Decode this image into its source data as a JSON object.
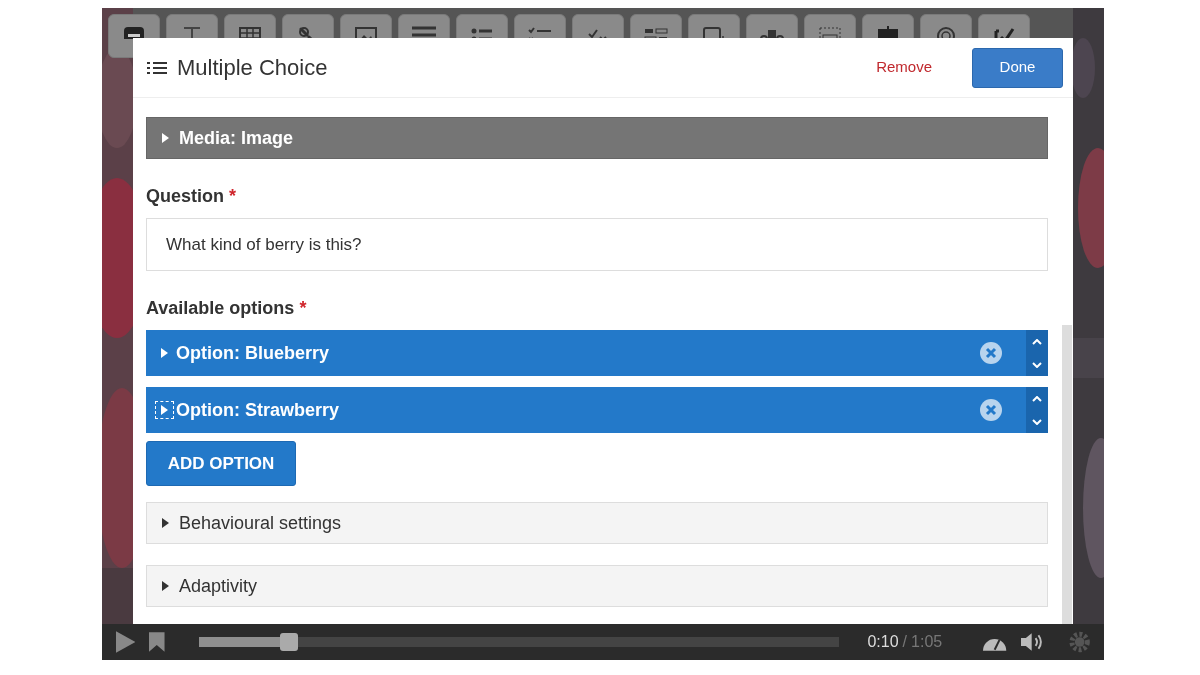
{
  "dialog": {
    "title": "Multiple Choice",
    "remove": "Remove",
    "done": "Done"
  },
  "media": {
    "label": "Media: Image",
    "expanded": false
  },
  "question": {
    "label": "Question",
    "required": "*",
    "value": "What kind of berry is this?"
  },
  "options": {
    "label": "Available options",
    "required": "*",
    "add_button": "ADD OPTION",
    "items": [
      {
        "label": "Option: Blueberry",
        "focused": false
      },
      {
        "label": "Option: Strawberry",
        "focused": true
      }
    ]
  },
  "sections": [
    {
      "label": "Behavioural settings",
      "expanded": false
    },
    {
      "label": "Adaptivity",
      "expanded": false
    }
  ],
  "player": {
    "current": "0:10",
    "separator": "/",
    "total": "1:05",
    "level": 0.14
  }
}
